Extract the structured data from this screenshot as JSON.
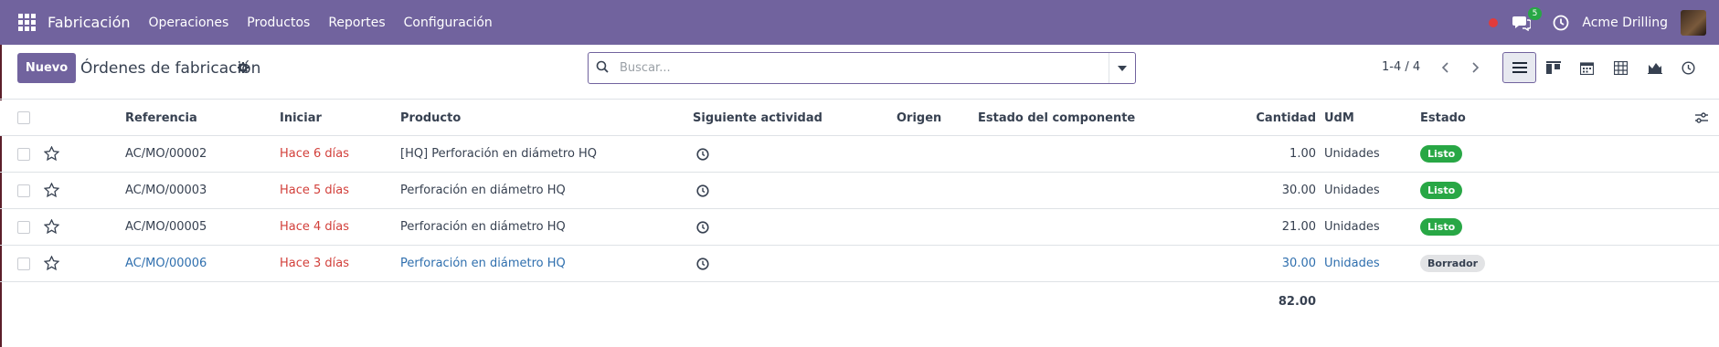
{
  "navbar": {
    "app_name": "Fabricación",
    "menu": [
      "Operaciones",
      "Productos",
      "Reportes",
      "Configuración"
    ],
    "chat_count": "5",
    "company": "Acme Drilling",
    "color": "#71639e"
  },
  "control_panel": {
    "new_button": "Nuevo",
    "title": "Órdenes de fabricación",
    "search_placeholder": "Buscar...",
    "pager": "1-4 / 4",
    "views": [
      "list-view-icon",
      "kanban-view-icon",
      "calendar-view-icon",
      "pivot-view-icon",
      "graph-view-icon",
      "activity-view-icon"
    ]
  },
  "table": {
    "columns": {
      "referencia": "Referencia",
      "iniciar": "Iniciar",
      "producto": "Producto",
      "siguiente_actividad": "Siguiente actividad",
      "origen": "Origen",
      "estado_componente": "Estado del componente",
      "cantidad": "Cantidad",
      "udm": "UdM",
      "estado": "Estado"
    },
    "rows": [
      {
        "ref": "AC/MO/00002",
        "start": "Hace 6 días",
        "product": "[HQ] Perforación en diámetro HQ",
        "qty": "1.00",
        "uom": "Unidades",
        "status": "Listo"
      },
      {
        "ref": "AC/MO/00003",
        "start": "Hace 5 días",
        "product": "Perforación en diámetro HQ",
        "qty": "30.00",
        "uom": "Unidades",
        "status": "Listo"
      },
      {
        "ref": "AC/MO/00005",
        "start": "Hace 4 días",
        "product": "Perforación en diámetro HQ",
        "qty": "21.00",
        "uom": "Unidades",
        "status": "Listo"
      },
      {
        "ref": "AC/MO/00006",
        "start": "Hace 3 días",
        "product": "Perforación en diámetro HQ",
        "qty": "30.00",
        "uom": "Unidades",
        "status": "Borrador"
      }
    ],
    "total": "82.00"
  }
}
